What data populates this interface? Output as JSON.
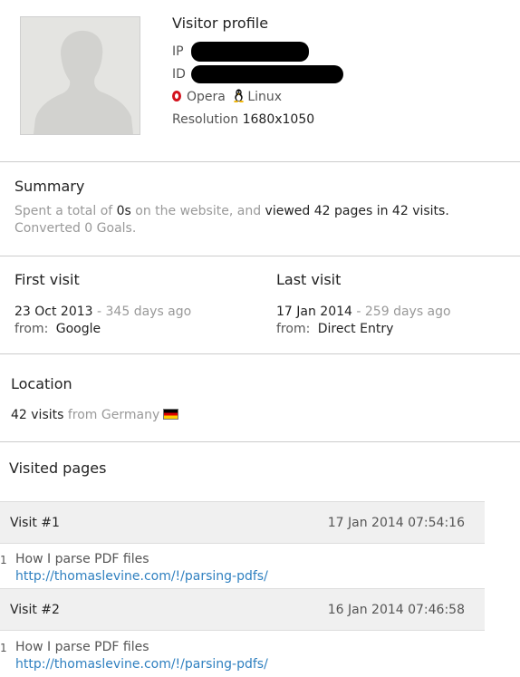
{
  "profile": {
    "title": "Visitor profile",
    "ip_label": "IP",
    "id_label": "ID",
    "browser": "Opera",
    "os": "Linux",
    "resolution_label": "Resolution",
    "resolution_value": "1680x1050"
  },
  "summary": {
    "title": "Summary",
    "text_prefix": "Spent a total of",
    "total_time": "0s",
    "text_mid": "on the website, and",
    "viewed_text": "viewed 42 pages in 42 visits.",
    "converted_text": "Converted 0 Goals."
  },
  "first_visit": {
    "title": "First visit",
    "date": "23 Oct 2013",
    "ago": "- 345 days ago",
    "from_label": "from:",
    "from_value": "Google"
  },
  "last_visit": {
    "title": "Last visit",
    "date": "17 Jan 2014",
    "ago": "- 259 days ago",
    "from_label": "from:",
    "from_value": "Direct Entry"
  },
  "location": {
    "title": "Location",
    "visits": "42 visits",
    "from_text": "from Germany"
  },
  "visited_pages": {
    "title": "Visited pages",
    "visits": [
      {
        "label": "Visit #1",
        "datetime": "17 Jan 2014 07:54:16",
        "pages": [
          {
            "num": "1",
            "title": "How I parse PDF files",
            "url": "http://thomaslevine.com/!/parsing-pdfs/"
          }
        ]
      },
      {
        "label": "Visit #2",
        "datetime": "16 Jan 2014 07:46:58",
        "pages": [
          {
            "num": "1",
            "title": "How I parse PDF files",
            "url": "http://thomaslevine.com/!/parsing-pdfs/"
          }
        ]
      }
    ]
  },
  "colors": {
    "link": "#2f80c0",
    "muted": "#999999",
    "opera_red": "#d3121d"
  }
}
